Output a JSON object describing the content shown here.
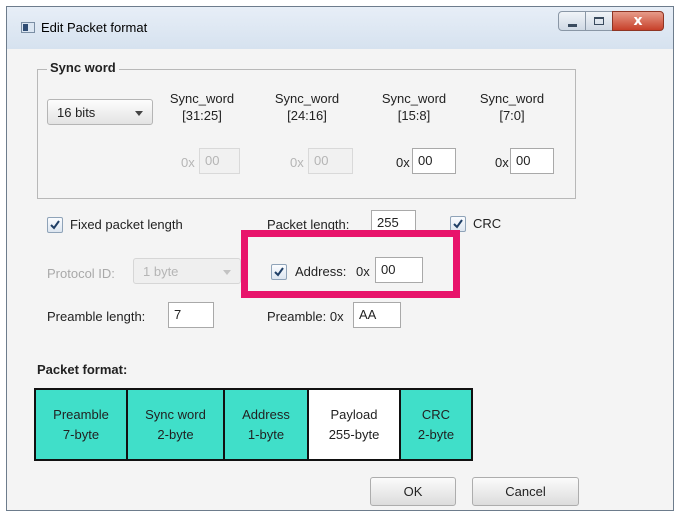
{
  "window": {
    "title": "Edit Packet format",
    "close_glyph": "x"
  },
  "sync_word": {
    "legend": "Sync word",
    "size_select": "16 bits",
    "columns": [
      {
        "label1": "Sync_word",
        "label2": "[31:25]",
        "prefix": "0x",
        "value": "00",
        "enabled": false
      },
      {
        "label1": "Sync_word",
        "label2": "[24:16]",
        "prefix": "0x",
        "value": "00",
        "enabled": false
      },
      {
        "label1": "Sync_word",
        "label2": "[15:8]",
        "prefix": "0x",
        "value": "00",
        "enabled": true
      },
      {
        "label1": "Sync_word",
        "label2": "[7:0]",
        "prefix": "0x",
        "value": "00",
        "enabled": true
      }
    ]
  },
  "options": {
    "fixed_length_label": "Fixed packet length",
    "fixed_length_checked": true,
    "packet_length_label": "Packet length:",
    "packet_length_value": "255",
    "crc_label": "CRC",
    "crc_checked": true,
    "protocol_id_label": "Protocol ID:",
    "protocol_id_value": "1 byte",
    "address_label": "Address:",
    "address_prefix": "0x",
    "address_value": "00",
    "address_checked": true,
    "preamble_length_label": "Preamble length:",
    "preamble_length_value": "7",
    "preamble_label": "Preamble: 0x",
    "preamble_value": "AA"
  },
  "packet_format": {
    "title": "Packet format:",
    "segments": [
      {
        "line1": "Preamble",
        "line2": "7-byte"
      },
      {
        "line1": "Sync word",
        "line2": "2-byte"
      },
      {
        "line1": "Address",
        "line2": "1-byte"
      },
      {
        "line1": "Payload",
        "line2": "255-byte"
      },
      {
        "line1": "CRC",
        "line2": "2-byte"
      }
    ]
  },
  "buttons": {
    "ok": "OK",
    "cancel": "Cancel"
  },
  "colors": {
    "segment_fill": "#40dfc9",
    "payload_fill": "#ffffff",
    "highlight": "#e8136b"
  },
  "icons": {
    "checkbox_check": "check-mark-icon",
    "dropdown": "chevron-down-icon",
    "app": "window-icon"
  }
}
